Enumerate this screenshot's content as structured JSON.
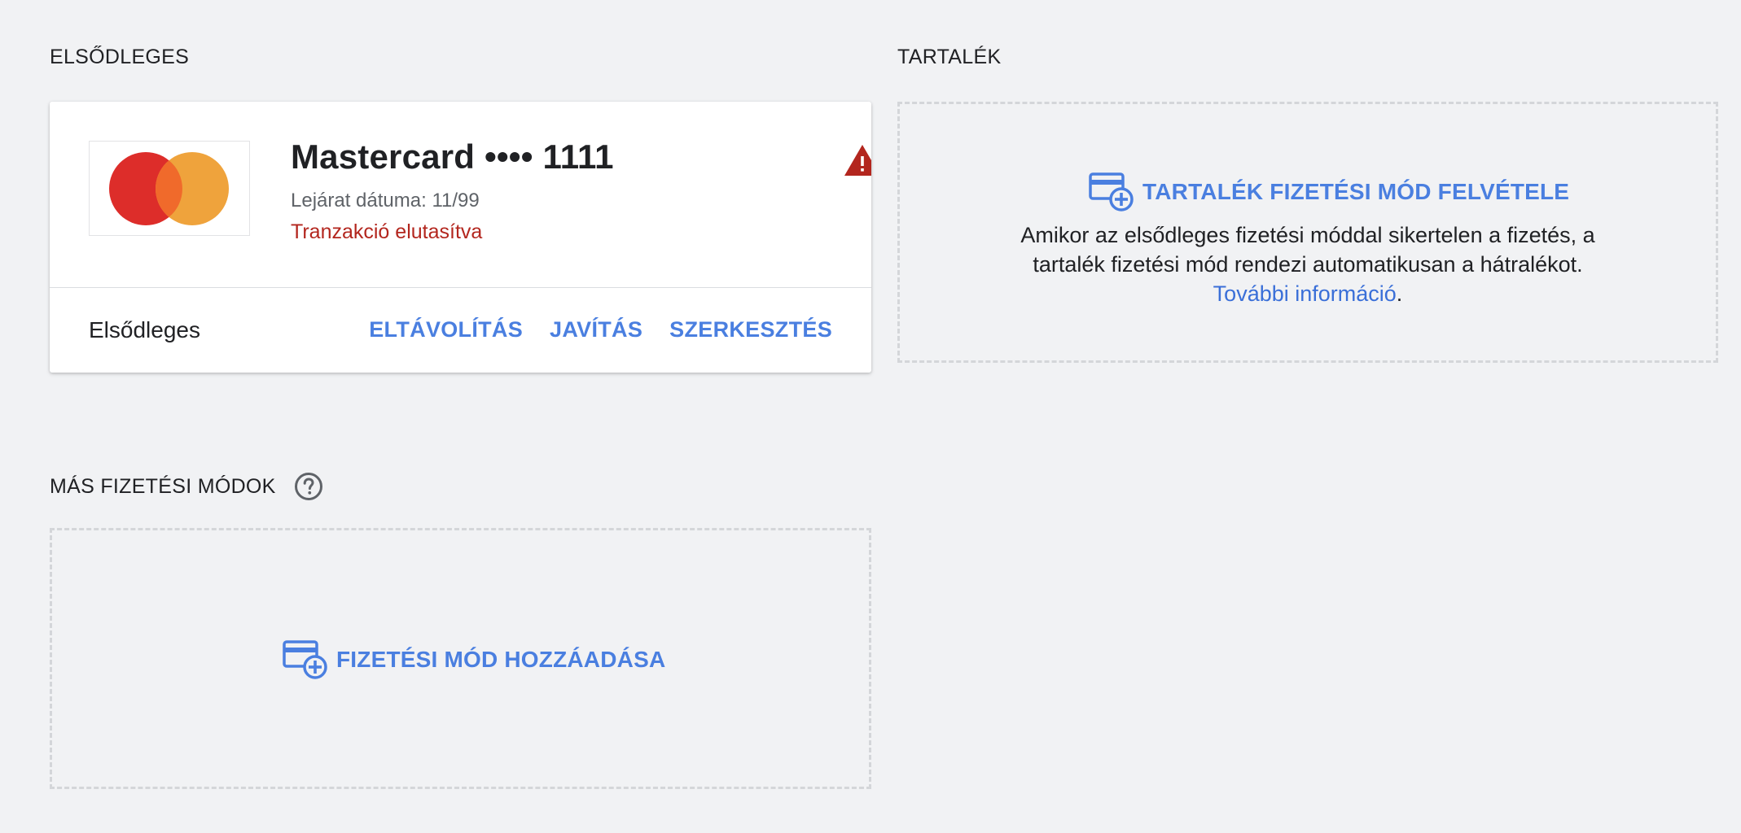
{
  "primary": {
    "section_title": "ELSŐDLEGES",
    "card": {
      "name": "Mastercard •••• 1111",
      "expiry": "Lejárat dátuma: 11/99",
      "status": "Tranzakció elutasítva",
      "label": "Elsődleges",
      "actions": {
        "remove": "ELTÁVOLÍTÁS",
        "fix": "JAVÍTÁS",
        "edit": "SZERKESZTÉS"
      }
    }
  },
  "backup": {
    "section_title": "TARTALÉK",
    "add_label": "TARTALÉK FIZETÉSI MÓD FELVÉTELE",
    "description_line1": "Amikor az elsődleges fizetési móddal sikertelen a fizetés, a",
    "description_line2": "tartalék fizetési mód rendezi automatikusan a hátralékot.",
    "learn_more": "További információ",
    "learn_more_suffix": "."
  },
  "other": {
    "section_title": "MÁS FIZETÉSI MÓDOK",
    "add_label": "FIZETÉSI MÓD HOZZÁADÁSA"
  },
  "icons": {
    "card_logo": "mastercard-logo",
    "warning": "warning-triangle-icon",
    "help": "help-circle-icon",
    "add_card": "add-card-icon"
  },
  "colors": {
    "accent": "#4a7fe0",
    "error": "#b3261e",
    "background": "#f1f2f4"
  }
}
